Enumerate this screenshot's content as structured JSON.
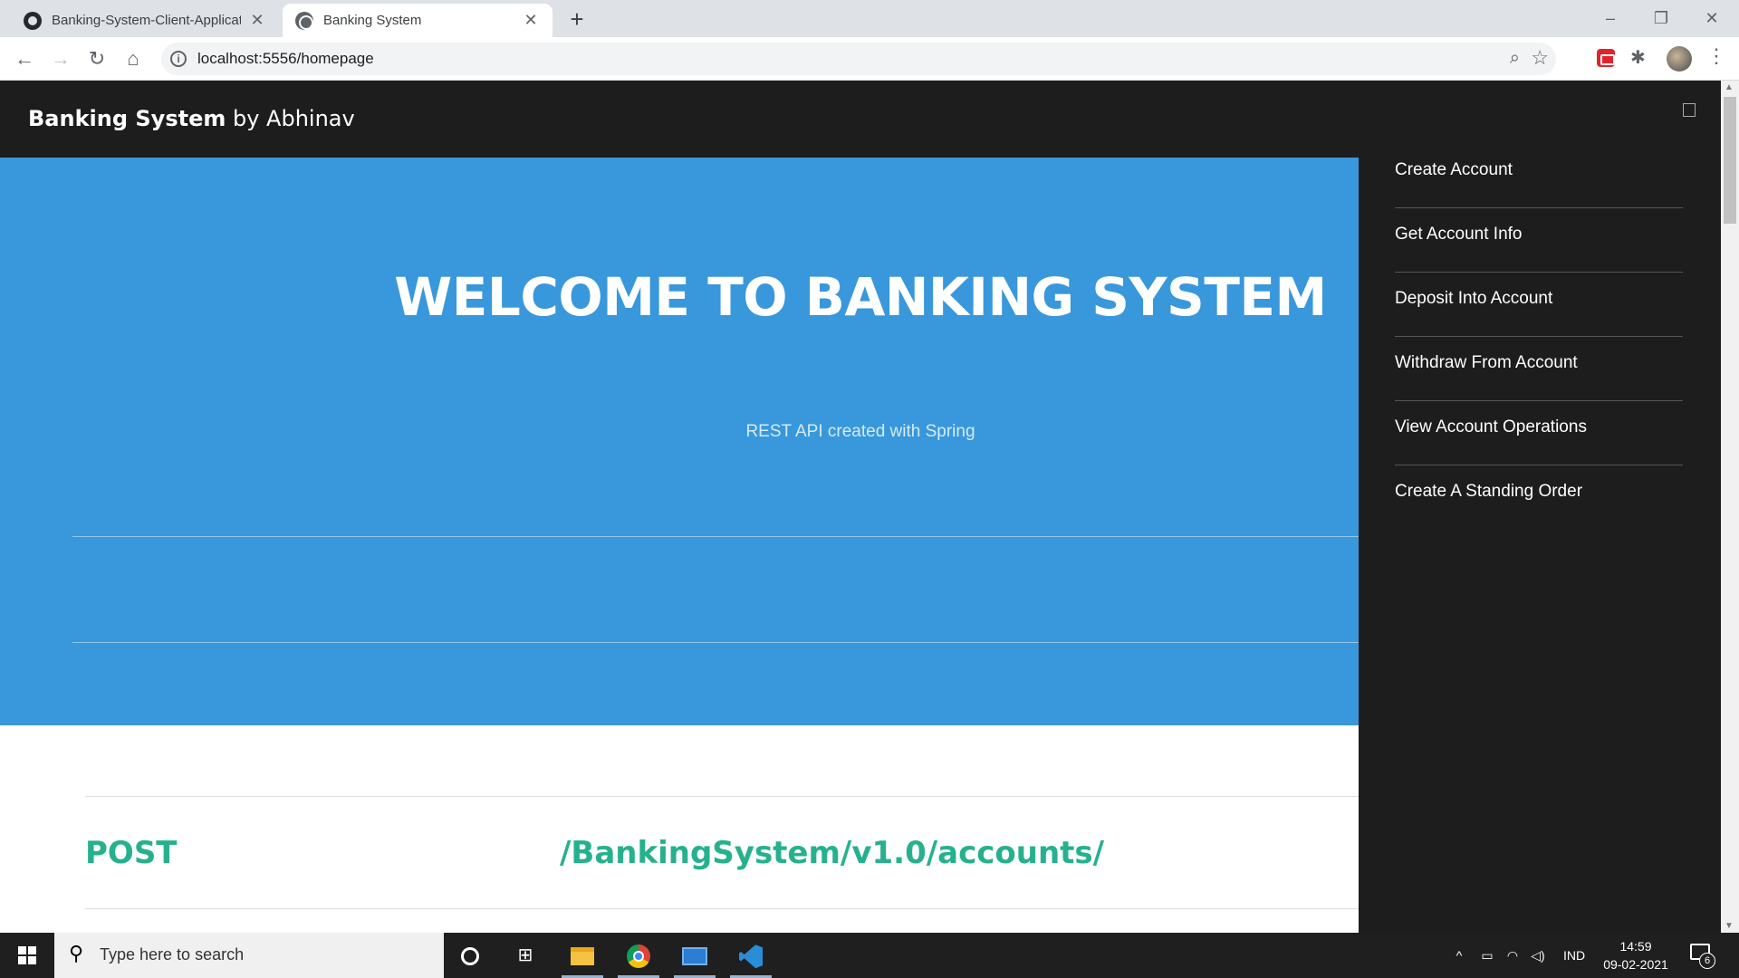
{
  "browser": {
    "tabs": [
      {
        "title": "Banking-System-Client-Application",
        "icon": "github-icon"
      },
      {
        "title": "Banking System",
        "icon": "globe-icon"
      }
    ],
    "url": "localhost:5556/homepage"
  },
  "site": {
    "brand_name": "Banking System",
    "brand_suffix": " by Abhinav",
    "hero_title": "WELCOME TO BANKING SYSTEM",
    "hero_subtitle": "REST API created with Spring",
    "endpoint_method": "POST",
    "endpoint_path": "/BankingSystem/v1.0/accounts/",
    "accent_color": "#3898db",
    "method_color": "#26b18e"
  },
  "sidebar": {
    "items": [
      {
        "label": "Create Account"
      },
      {
        "label": "Get Account Info"
      },
      {
        "label": "Deposit Into Account"
      },
      {
        "label": "Withdraw From Account"
      },
      {
        "label": "View Account Operations"
      },
      {
        "label": "Create A Standing Order"
      }
    ]
  },
  "taskbar": {
    "search_placeholder": "Type here to search",
    "language": "IND",
    "time": "14:59",
    "date": "09-02-2021",
    "notification_count": "6"
  }
}
